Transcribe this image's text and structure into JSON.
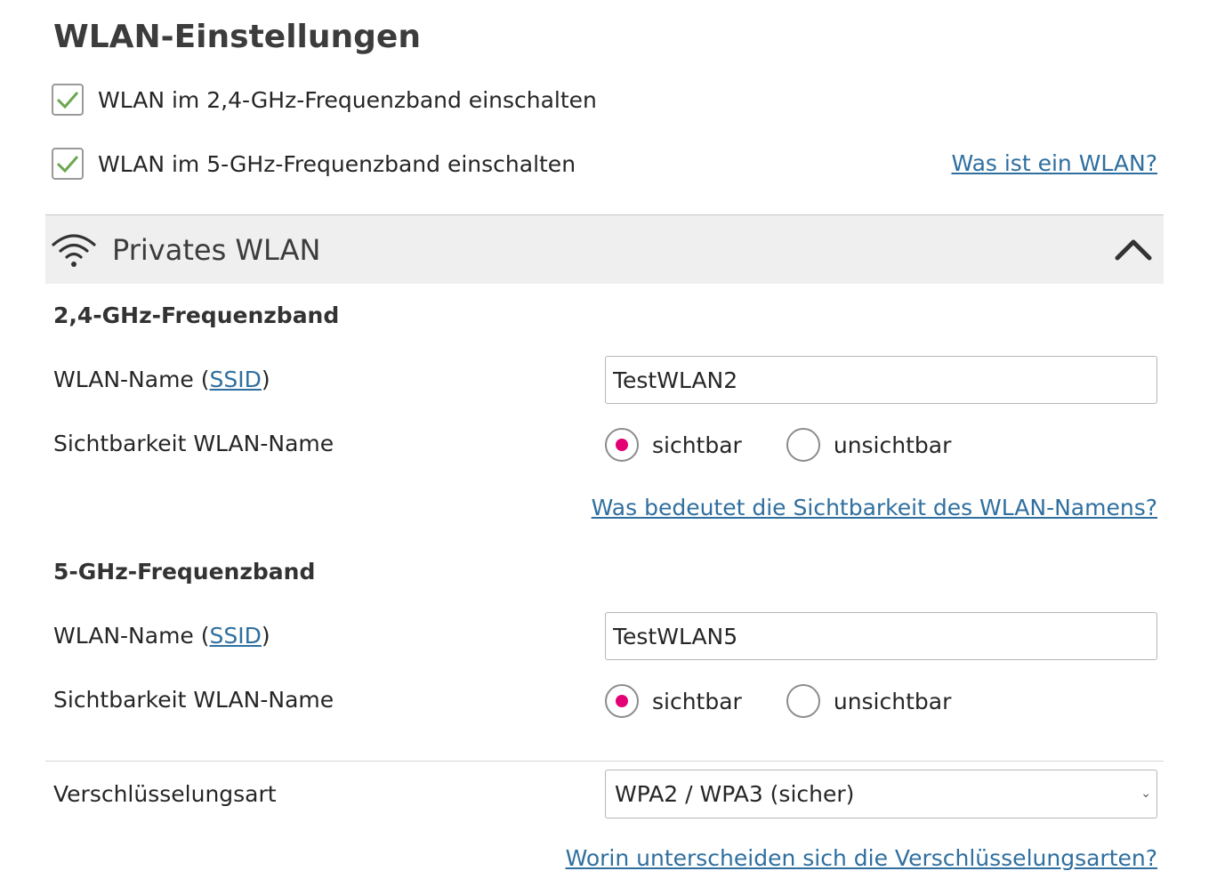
{
  "page": {
    "title": "WLAN-Einstellungen"
  },
  "toggles": [
    {
      "label": "WLAN im 2,4-GHz-Frequenzband einschalten",
      "checked": true
    },
    {
      "label": "WLAN im 5-GHz-Frequenzband einschalten",
      "checked": true
    }
  ],
  "help_links": {
    "what_is_wlan": "Was ist ein WLAN?",
    "visibility": "Was bedeutet die Sichtbarkeit des WLAN-Namens?",
    "encryption": "Worin unterscheiden sich die Verschlüsselungsarten?"
  },
  "panel": {
    "title": "Privates WLAN",
    "icon": "wifi-icon",
    "collapse_icon": "chevron-up-icon"
  },
  "bands": [
    {
      "heading": "2,4-GHz-Frequenzband",
      "ssid_label_prefix": "WLAN-Name (",
      "ssid_label_link": "SSID",
      "ssid_label_suffix": ")",
      "ssid_value": "TestWLAN2",
      "visibility_label": "Sichtbarkeit WLAN-Name",
      "options": [
        "sichtbar",
        "unsichtbar"
      ],
      "selected": "sichtbar"
    },
    {
      "heading": "5-GHz-Frequenzband",
      "ssid_label_prefix": "WLAN-Name (",
      "ssid_label_link": "SSID",
      "ssid_label_suffix": ")",
      "ssid_value": "TestWLAN5",
      "visibility_label": "Sichtbarkeit WLAN-Name",
      "options": [
        "sichtbar",
        "unsichtbar"
      ],
      "selected": "sichtbar"
    }
  ],
  "encryption": {
    "label": "Verschlüsselungsart",
    "selected": "WPA2 / WPA3 (sicher)"
  },
  "colors": {
    "accent": "#e20074",
    "link": "#2f6f9f",
    "check": "#6aa84f",
    "panel_bg": "#efefef"
  }
}
